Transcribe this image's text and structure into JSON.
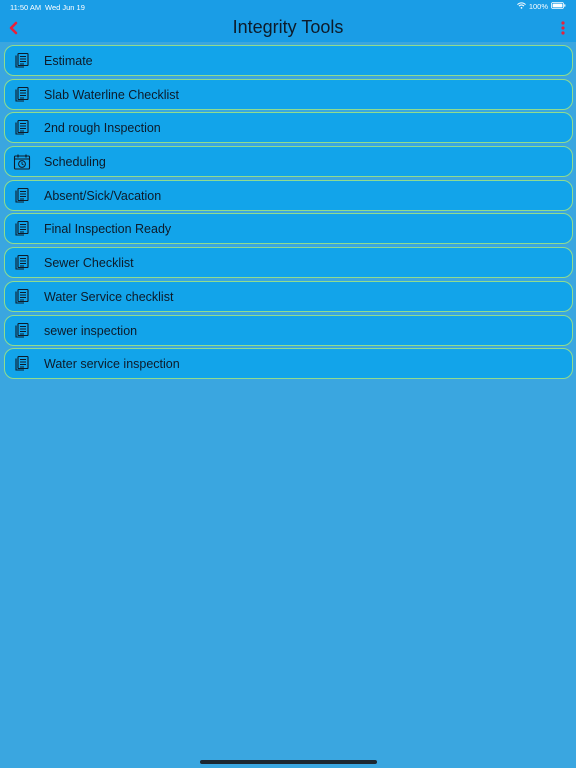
{
  "status_bar": {
    "time": "11:50 AM",
    "date": "Wed Jun 19",
    "battery": "100%",
    "wifi_icon": "wifi-icon",
    "battery_icon": "battery-icon"
  },
  "header": {
    "title": "Integrity Tools",
    "back_icon": "chevron-left-icon",
    "menu_icon": "more-vertical-icon"
  },
  "colors": {
    "header_bg": "#1a9de6",
    "page_bg": "#3aa6e0",
    "item_bg": "#12a4ea",
    "item_border": "#8fdc8f",
    "accent_red": "#e8203a"
  },
  "items": [
    {
      "label": "Estimate",
      "icon": "document-list-icon"
    },
    {
      "label": "Slab Waterline Checklist",
      "icon": "document-list-icon"
    },
    {
      "label": "2nd rough Inspection",
      "icon": "document-list-icon"
    },
    {
      "label": "Scheduling",
      "icon": "calendar-clock-icon"
    },
    {
      "label": "Absent/Sick/Vacation",
      "icon": "document-list-icon"
    },
    {
      "label": "Final Inspection Ready",
      "icon": "document-list-icon"
    },
    {
      "label": "Sewer Checklist",
      "icon": "document-list-icon"
    },
    {
      "label": "Water Service checklist",
      "icon": "document-list-icon"
    },
    {
      "label": "sewer inspection",
      "icon": "document-list-icon"
    },
    {
      "label": "Water service inspection",
      "icon": "document-list-icon"
    }
  ]
}
